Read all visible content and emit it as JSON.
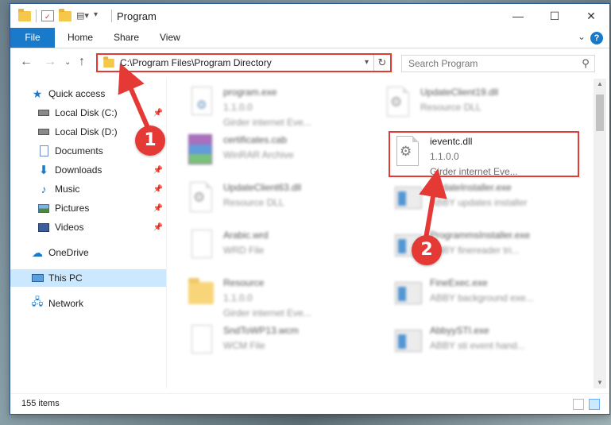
{
  "window": {
    "title": "Program",
    "controls": {
      "minimize": "—",
      "maximize": "☐",
      "close": "✕"
    }
  },
  "ribbon": {
    "tabs": [
      "File",
      "Home",
      "Share",
      "View"
    ]
  },
  "navigation": {
    "address": "C:\\Program Files\\Program Directory",
    "search_placeholder": "Search Program"
  },
  "sidebar": {
    "quick_access": "Quick access",
    "items": [
      {
        "label": "Local Disk (C:)",
        "icon": "drive-icon",
        "pinned": true
      },
      {
        "label": "Local Disk (D:)",
        "icon": "drive-icon",
        "pinned": true
      },
      {
        "label": "Documents",
        "icon": "documents-icon",
        "pinned": true
      },
      {
        "label": "Downloads",
        "icon": "downloads-icon",
        "pinned": true
      },
      {
        "label": "Music",
        "icon": "music-icon",
        "pinned": true
      },
      {
        "label": "Pictures",
        "icon": "pictures-icon",
        "pinned": true
      },
      {
        "label": "Videos",
        "icon": "videos-icon",
        "pinned": true
      }
    ],
    "onedrive": "OneDrive",
    "this_pc": "This PC",
    "network": "Network"
  },
  "files": [
    {
      "name": "program.exe",
      "line2": "1.1.0.0",
      "line3": "Girder internet Eve...",
      "icon": "exe-settings-icon"
    },
    {
      "name": "certificates.cab",
      "line2": "WinRAR Archive",
      "line3": "",
      "icon": "winrar-icon"
    },
    {
      "name": "UpdateClient63.dll",
      "line2": "Resource DLL",
      "line3": "",
      "icon": "dll-icon"
    },
    {
      "name": "Arabic.wrd",
      "line2": "WRD File",
      "line3": "",
      "icon": "blank-file-icon"
    },
    {
      "name": "Resource",
      "line2": "1.1.0.0",
      "line3": "Girder internet Eve...",
      "icon": "folder-icon"
    },
    {
      "name": "SndToWP13.wcm",
      "line2": "WCM File",
      "line3": "",
      "icon": "blank-file-icon"
    },
    {
      "name": "UpdateClient19.dll",
      "line2": "Resource DLL",
      "line3": "",
      "icon": "dll-icon"
    },
    {
      "name": "ievent c.dll",
      "line2": "1.1.0.0",
      "line3": "Girder internet Eve...",
      "icon": "dll-icon"
    },
    {
      "name": "UpdateInstaller.exe",
      "line2": "ABBY updates installer",
      "line3": "",
      "icon": "exe-icon"
    },
    {
      "name": "ProgrammsInstaller.exe",
      "line2": "ABBY finereader tri...",
      "line3": "",
      "icon": "exe-icon"
    },
    {
      "name": "FineExec.exe",
      "line2": "ABBY background exe...",
      "line3": "",
      "icon": "exe-icon"
    },
    {
      "name": "AbbyySTI.exe",
      "line2": "ABBY sti event hand...",
      "line3": "",
      "icon": "exe-icon"
    }
  ],
  "highlighted": {
    "name": "ieventc.dll",
    "line2": "1.1.0.0",
    "line3": "Girder internet Eve..."
  },
  "status": {
    "items_count": "155 items"
  },
  "annotations": {
    "step1": "1",
    "step2": "2"
  },
  "colors": {
    "accent": "#1979ca",
    "highlight": "#e53935",
    "selection": "#cce8ff"
  }
}
